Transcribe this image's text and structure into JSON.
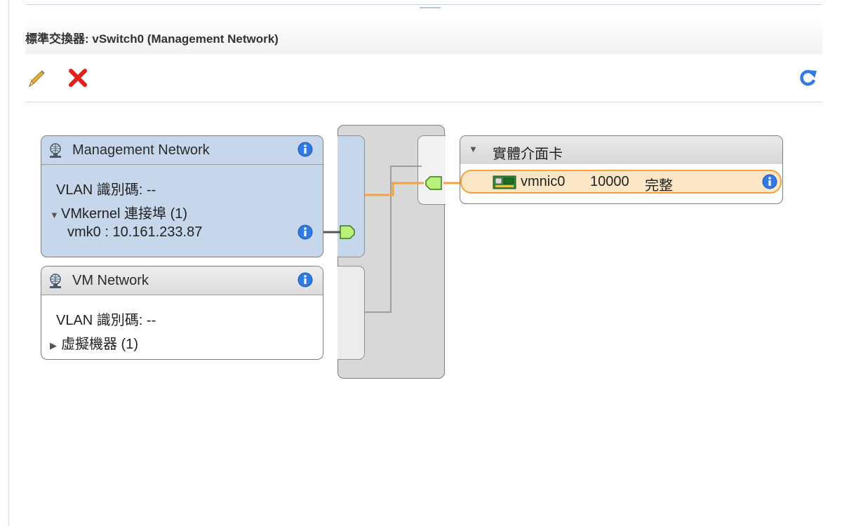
{
  "page": {
    "title": "標準交換器: vSwitch0 (Management Network)"
  },
  "toolbar": {
    "edit_icon": "pencil-icon",
    "delete_icon": "red-x-icon",
    "refresh_icon": "refresh-icon"
  },
  "port_groups": [
    {
      "name": "Management Network",
      "vlan_label": "VLAN 識別碼: --",
      "vmkernel_ports_label": "VMkernel 連接埠 (1)",
      "vmk_entry": "vmk0 : 10.161.233.87",
      "selected": true
    },
    {
      "name": "VM Network",
      "vlan_label": "VLAN 識別碼: --",
      "vms_label": "虛擬機器 (1)",
      "selected": false
    }
  ],
  "physical_adapters": {
    "header": "實體介面卡",
    "adapters": [
      {
        "name": "vmnic0",
        "speed": "10000",
        "duplex": "完整"
      }
    ]
  },
  "colors": {
    "selected_fill": "#c6d7ec",
    "active_link": "#f0a340",
    "port_green": "#b9f07a",
    "info_blue": "#2f7ae5",
    "delete_red": "#e0201d"
  }
}
